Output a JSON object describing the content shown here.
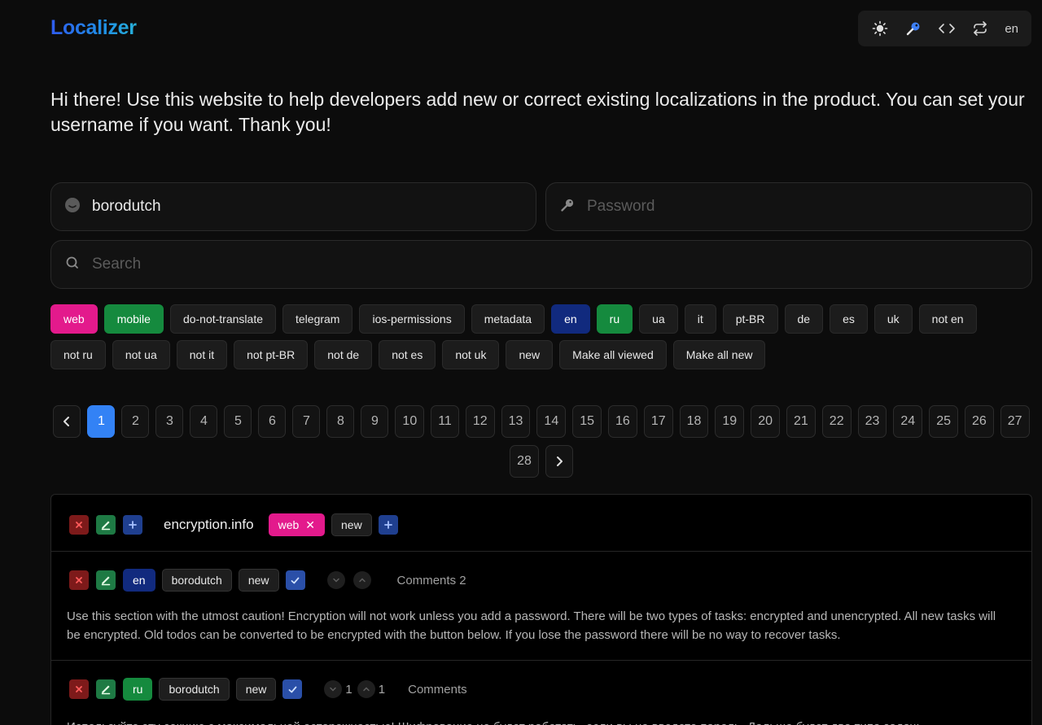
{
  "app": {
    "logo": "Localizer"
  },
  "toolbar": {
    "lang": "en"
  },
  "intro": "Hi there! Use this website to help developers add new or correct existing localizations in the product. You can set your username if you want. Thank you!",
  "inputs": {
    "username_value": "borodutch",
    "password_placeholder": "Password",
    "search_placeholder": "Search"
  },
  "tags": [
    {
      "label": "web",
      "color": "#e31a8c"
    },
    {
      "label": "mobile",
      "color": "#158a3e"
    },
    {
      "label": "do-not-translate"
    },
    {
      "label": "telegram"
    },
    {
      "label": "ios-permissions"
    },
    {
      "label": "metadata"
    },
    {
      "label": "en",
      "color": "#112a7e"
    },
    {
      "label": "ru",
      "color": "#158a3e"
    },
    {
      "label": "ua"
    },
    {
      "label": "it"
    },
    {
      "label": "pt-BR"
    },
    {
      "label": "de"
    },
    {
      "label": "es"
    },
    {
      "label": "uk"
    },
    {
      "label": "not en"
    },
    {
      "label": "not ru"
    },
    {
      "label": "not ua"
    },
    {
      "label": "not it"
    },
    {
      "label": "not pt-BR"
    },
    {
      "label": "not de"
    },
    {
      "label": "not es"
    },
    {
      "label": "not uk"
    },
    {
      "label": "new"
    },
    {
      "label": "Make all viewed"
    },
    {
      "label": "Make all new"
    }
  ],
  "pagination": {
    "current": "1",
    "pages": [
      "1",
      "2",
      "3",
      "4",
      "5",
      "6",
      "7",
      "8",
      "9",
      "10",
      "11",
      "12",
      "13",
      "14",
      "15",
      "16",
      "17",
      "18",
      "19",
      "20",
      "21",
      "22",
      "23",
      "24",
      "25",
      "26",
      "27",
      "28"
    ]
  },
  "entry": {
    "key": "encryption.info",
    "tags": [
      "web",
      "new"
    ],
    "variants": [
      {
        "lang": "en",
        "user": "borodutch",
        "status": "new",
        "downvotes": "",
        "upvotes": "",
        "comments": "Comments 2",
        "text": "Use this section with the utmost caution! Encryption will not work unless you add a password. There will be two types of tasks: encrypted and unencrypted. All new tasks will be encrypted. Old todos can be converted to be encrypted with the button below. If you lose the password there will be no way to recover tasks."
      },
      {
        "lang": "ru",
        "user": "borodutch",
        "status": "new",
        "downvotes": "1",
        "upvotes": "1",
        "comments": "Comments",
        "text": "Используйте эту секцию с максимальной осторожностью! Шифрование не будет работать, если вы не введете пароль. Дальше будет два типа задач:"
      }
    ]
  },
  "colors": {
    "accent": "#3382f5",
    "pink": "#e31a8c",
    "green": "#158a3e",
    "navy": "#112a7e",
    "danger": "#7d1a1a"
  },
  "icons": [
    "sun-icon",
    "key-icon",
    "code-icon",
    "repeat-icon",
    "user-icon",
    "search-icon",
    "close-icon",
    "edit-icon",
    "plus-icon",
    "check-icon",
    "chevron-left-icon",
    "chevron-right-icon",
    "chevron-down-icon",
    "chevron-up-icon"
  ]
}
